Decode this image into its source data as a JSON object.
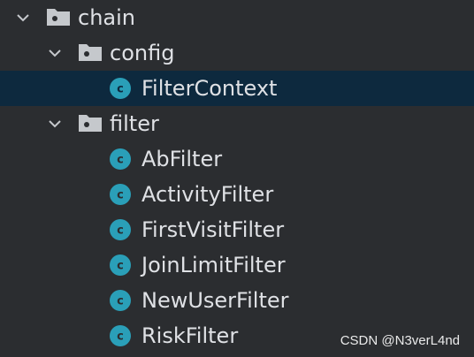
{
  "tree": {
    "chain": {
      "label": "chain",
      "icon": "folder-icon",
      "expanded": true
    },
    "config": {
      "label": "config",
      "icon": "folder-icon",
      "expanded": true
    },
    "filter_context": {
      "label": "FilterContext",
      "icon": "class-icon",
      "selected": true
    },
    "filter": {
      "label": "filter",
      "icon": "folder-icon",
      "expanded": true
    },
    "ab_filter": {
      "label": "AbFilter",
      "icon": "class-icon"
    },
    "activity_filter": {
      "label": "ActivityFilter",
      "icon": "class-icon"
    },
    "first_visit_filter": {
      "label": "FirstVisitFilter",
      "icon": "class-icon"
    },
    "join_limit_filter": {
      "label": "JoinLimitFilter",
      "icon": "class-icon"
    },
    "new_user_filter": {
      "label": "NewUserFilter",
      "icon": "class-icon"
    },
    "risk_filter": {
      "label": "RiskFilter",
      "icon": "class-icon"
    }
  },
  "watermark": {
    "text": "CSDN @N3verL4nd"
  },
  "colors": {
    "background": "#2b2d30",
    "selected_row": "#0d293e",
    "text": "#dfe1e5",
    "class_icon": "#2a9fb8",
    "folder": "#c5c8cc",
    "chevron": "#c5c8cc"
  }
}
